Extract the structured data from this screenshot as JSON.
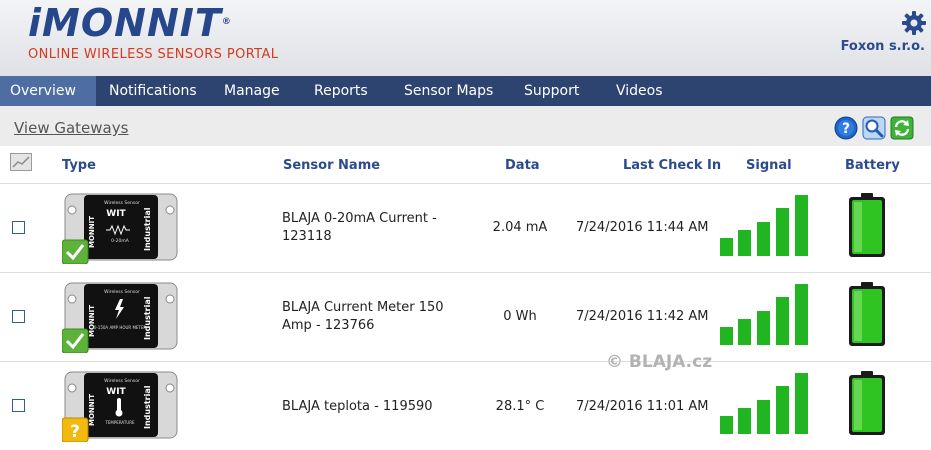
{
  "header": {
    "logo": "iMONNIT",
    "tagline": "ONLINE WIRELESS SENSORS PORTAL",
    "company": "Foxon s.r.o.",
    "settings_icon": "gear-icon"
  },
  "nav": {
    "items": [
      {
        "label": "Overview",
        "active": true
      },
      {
        "label": "Notifications",
        "active": false
      },
      {
        "label": "Manage",
        "active": false
      },
      {
        "label": "Reports",
        "active": false
      },
      {
        "label": "Sensor Maps",
        "active": false
      },
      {
        "label": "Support",
        "active": false
      },
      {
        "label": "Videos",
        "active": false
      }
    ]
  },
  "toolbar": {
    "view_gateways": "View Gateways",
    "icons": [
      "help-icon",
      "search-icon",
      "refresh-icon"
    ]
  },
  "table": {
    "columns": {
      "type": "Type",
      "sensor_name": "Sensor Name",
      "data": "Data",
      "last_check_in": "Last Check In",
      "signal": "Signal",
      "battery": "Battery"
    },
    "rows": [
      {
        "name_line1": "BLAJA 0-20mA Current -",
        "name_line2": "123118",
        "data": "2.04 mA",
        "last_check_in": "7/24/2016 11:44 AM",
        "status": "ok",
        "signal_bars": 5,
        "battery_level": 1.0,
        "device_brand": "MONNIT",
        "device_model": "WIT",
        "device_side": "Industrial",
        "device_top": "Wireless Sensor",
        "device_label": "0-20mA"
      },
      {
        "name_line1": "BLAJA Current Meter 150",
        "name_line2": "Amp - 123766",
        "data": "0 Wh",
        "last_check_in": "7/24/2016 11:42 AM",
        "status": "ok",
        "signal_bars": 5,
        "battery_level": 1.0,
        "device_brand": "MONNIT",
        "device_model": "",
        "device_side": "Industrial",
        "device_top": "Wireless Sensor",
        "device_label": "0-150A AMP HOUR METER"
      },
      {
        "name_line1": "BLAJA teplota - 119590",
        "name_line2": "",
        "data": "28.1° C",
        "last_check_in": "7/24/2016 11:01 AM",
        "status": "unknown",
        "signal_bars": 5,
        "battery_level": 1.0,
        "device_brand": "MONNIT",
        "device_model": "WIT",
        "device_side": "Industrial",
        "device_top": "Wireless Sensor",
        "device_label": "TEMPERATURE"
      }
    ]
  },
  "watermark": "© BLAJA.cz",
  "colors": {
    "nav_bg": "#2e4470",
    "nav_active": "#4e6ea3",
    "brand_blue": "#27478c",
    "tagline_red": "#d63a1e",
    "signal_green": "#22b522",
    "ok_green": "#5db33a",
    "warn_yellow": "#f2b90f"
  }
}
